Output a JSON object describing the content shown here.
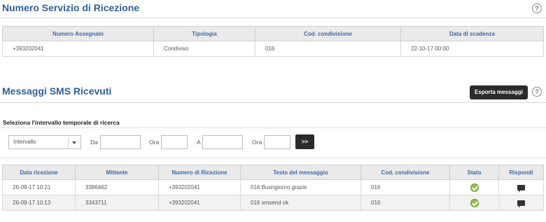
{
  "service": {
    "title": "Numero Servizio di Ricezione",
    "help": "?",
    "columns": [
      "Numero Assegnato",
      "Tipologia",
      "Cod. condivisione",
      "Data di scadenza"
    ],
    "row": [
      "+393202041",
      "Condiviso",
      "016",
      "22-10-17 00:00"
    ]
  },
  "sms": {
    "title": "Messaggi SMS Ricevuti",
    "export_label": "Esporta messaggi",
    "help": "?",
    "filter": {
      "title": "Seleziona l'intervallo temporale di ricerca",
      "select_value": "Intervallo",
      "da_label": "Da",
      "ora1_label": "Ora",
      "a_label": "A",
      "ora2_label": "Ora",
      "da_value": "",
      "ora1_value": "",
      "a_value": "",
      "ora2_value": "",
      "go_label": ">>"
    },
    "columns": [
      "Data ricezione",
      "Mittente",
      "Numero di Ricezione",
      "Testo del messaggio",
      "Cod. condivisione",
      "Stato",
      "Rispondi"
    ],
    "rows": [
      {
        "date": "26-09-17 10:21",
        "sender": "3386462",
        "number": "+393202041",
        "text": "016 Buongiorno grazie",
        "code": "016",
        "status_icon": "check-icon",
        "reply_icon": "chat-icon"
      },
      {
        "date": "26-09-17 10:13",
        "sender": "3343711",
        "number": "+393202041",
        "text": "016 smsend ok",
        "code": "016",
        "status_icon": "check-icon",
        "reply_icon": "chat-icon"
      }
    ]
  },
  "colors": {
    "title": "#2f5f9c",
    "header_text": "#3a6aa8",
    "button": "#2b2b2b",
    "status_ok": "#8fc23b"
  }
}
